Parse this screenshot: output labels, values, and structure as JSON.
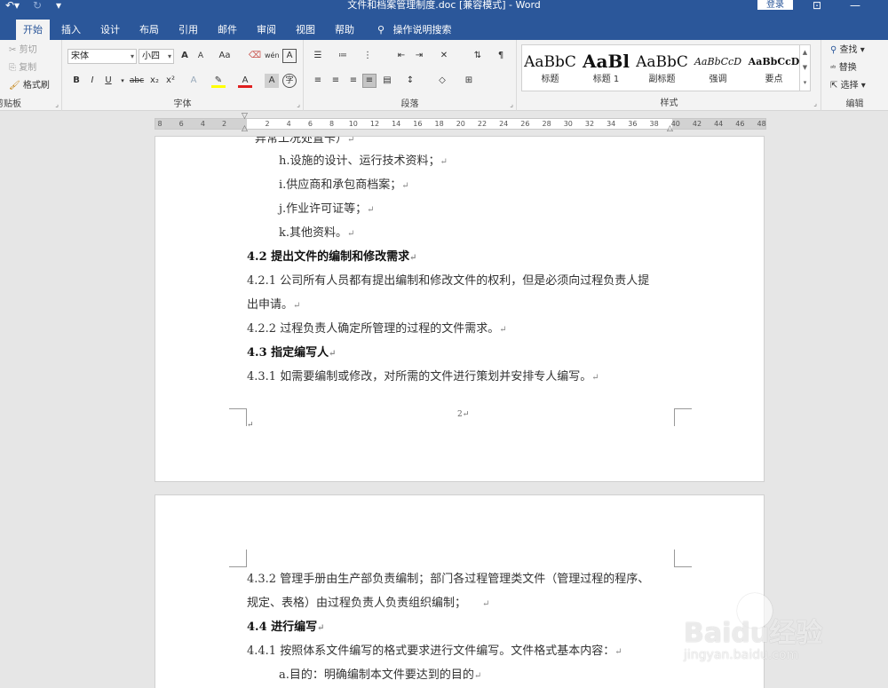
{
  "titlebar": {
    "title": "文件和档案管理制度.doc [兼容模式] - Word",
    "login": "登录",
    "undo_icon": "undo-icon",
    "redo_icon": "redo-icon"
  },
  "tabs": [
    {
      "label": "开始",
      "active": true
    },
    {
      "label": "插入"
    },
    {
      "label": "设计"
    },
    {
      "label": "布局"
    },
    {
      "label": "引用"
    },
    {
      "label": "邮件"
    },
    {
      "label": "审阅"
    },
    {
      "label": "视图"
    },
    {
      "label": "帮助"
    }
  ],
  "tell_me": "操作说明搜索",
  "clipboard": {
    "cut": "剪切",
    "copy": "复制",
    "format_painter": "格式刷",
    "label": "剪贴板"
  },
  "font": {
    "name": "宋体",
    "size": "小四",
    "label": "字体",
    "grow": "A",
    "shrink": "A",
    "case": "Aa",
    "phonetic": "wén",
    "border_char": "A",
    "bold": "B",
    "italic": "I",
    "underline": "U",
    "strike": "abc",
    "sub": "x₂",
    "sup": "x²",
    "effects": "A",
    "color": "A",
    "shade": "A",
    "enclose": "字"
  },
  "paragraph": {
    "label": "段落"
  },
  "styles": {
    "label": "样式",
    "items": [
      {
        "sample": "AaBbC",
        "name": "标题"
      },
      {
        "sample": "AaBl",
        "name": "标题 1"
      },
      {
        "sample": "AaBbC",
        "name": "副标题"
      },
      {
        "sample": "AaBbCcD",
        "name": "强调"
      },
      {
        "sample": "AaBbCcD",
        "name": "要点"
      }
    ]
  },
  "editing": {
    "find": "查找",
    "replace": "替换",
    "select": "选择",
    "label": "编辑"
  },
  "ruler": {
    "ticks": [
      "8",
      "6",
      "4",
      "2",
      "",
      "2",
      "4",
      "6",
      "8",
      "10",
      "12",
      "14",
      "16",
      "18",
      "20",
      "22",
      "24",
      "26",
      "28",
      "30",
      "32",
      "34",
      "36",
      "38",
      "40",
      "42",
      "44",
      "46",
      "48"
    ]
  },
  "page1": {
    "lines": [
      {
        "text": "异常工况处置卡）",
        "mark": "↵"
      },
      {
        "text": "h.设施的设计、运行技术资料；",
        "mark": "↵"
      },
      {
        "text": "i.供应商和承包商档案；",
        "mark": "↵"
      },
      {
        "text": "j.作业许可证等；",
        "mark": "↵"
      },
      {
        "text": "k.其他资料。",
        "mark": "↵"
      },
      {
        "text": "4.2 提出文件的编制和修改需求",
        "mark": "↵"
      },
      {
        "text": "4.2.1 公司所有人员都有提出编制和修改文件的权利，但是必须向过程负责人提",
        "mark": ""
      },
      {
        "text": "出申请。",
        "mark": "↵"
      },
      {
        "text": "4.2.2 过程负责人确定所管理的过程的文件需求。",
        "mark": "↵"
      },
      {
        "text": "4.3 指定编写人",
        "mark": "↵"
      },
      {
        "text": "4.3.1 如需要编制或修改，对所需的文件进行策划并安排专人编写。",
        "mark": "↵"
      }
    ],
    "page_number": "2↵",
    "end_mark": "↵"
  },
  "page2": {
    "lines": [
      {
        "text": "4.3.2 管理手册由生产部负责编制；部门各过程管理类文件（管理过程的程序、",
        "mark": ""
      },
      {
        "text": "规定、表格）由过程负责人负责组织编制；",
        "mark": "↵"
      },
      {
        "text": "4.4 进行编写",
        "mark": "↵"
      },
      {
        "text": "4.4.1 按照体系文件编写的格式要求进行文件编写。文件格式基本内容：",
        "mark": "↵"
      },
      {
        "text": "a.目的：明确编制本文件要达到的目的",
        "mark": "↵"
      }
    ]
  },
  "watermark": {
    "main": "Baidu经验",
    "sub": "jingyan.baidu.com"
  },
  "colors": {
    "accent": "#2b579a",
    "ribbon_bg": "#f3f3f3",
    "canvas_bg": "#e6e6e6"
  }
}
